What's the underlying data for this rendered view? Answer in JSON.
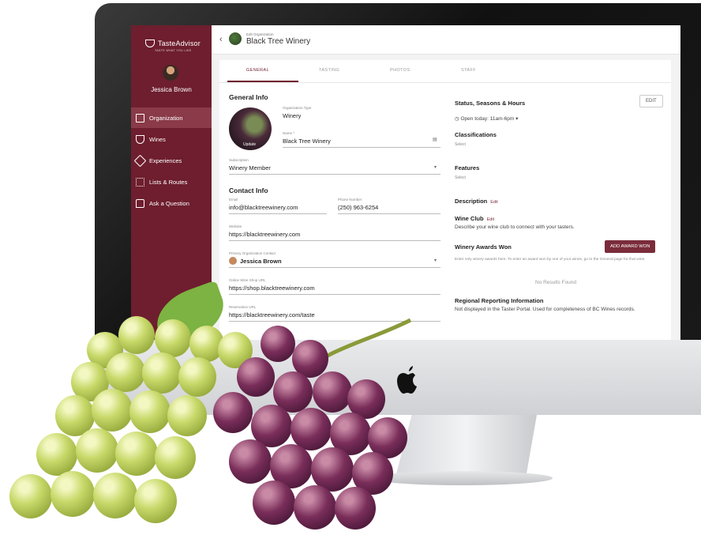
{
  "app": {
    "logo_text": "TasteAdvisor",
    "logo_tagline": "TASTE WHAT YOU LIKE"
  },
  "user": {
    "name": "Jessica Brown"
  },
  "sidebar": {
    "items": [
      {
        "label": "Organization",
        "icon": "building-icon",
        "active": true
      },
      {
        "label": "Wines",
        "icon": "wine-glass-icon"
      },
      {
        "label": "Experiences",
        "icon": "ticket-icon"
      },
      {
        "label": "Lists & Routes",
        "icon": "route-icon"
      },
      {
        "label": "Ask a Question",
        "icon": "chat-icon"
      }
    ]
  },
  "header": {
    "breadcrumb": "Edit Organization",
    "title": "Black Tree Winery"
  },
  "tabs": [
    "GENERAL",
    "TASTING",
    "PHOTOS",
    "STAFF"
  ],
  "general": {
    "heading": "General Info",
    "org_image_label": "Update",
    "org_type_label": "Organization Type",
    "org_type_value": "Winery",
    "name_label": "Name *",
    "name_value": "Black Tree Winery",
    "subscription_label": "Subscription",
    "subscription_value": "Winery Member"
  },
  "contact": {
    "heading": "Contact Info",
    "email_label": "Email",
    "email_value": "info@blacktreewinery.com",
    "phone_label": "Phone Number",
    "phone_value": "(250) 963-6254",
    "website_label": "Website",
    "website_value": "https://blacktreewinery.com",
    "primary_contact_label": "Primary Organization Contact",
    "primary_contact_value": "Jessica Brown",
    "shop_label": "Online Wine Shop URL",
    "shop_value": "https://shop.blacktreewinery.com",
    "reservation_label": "Reservation URL",
    "reservation_value": "https://blacktreewinery.com/taste"
  },
  "right": {
    "status_heading": "Status, Seasons & Hours",
    "edit_label": "EDIT",
    "open_today": "Open today: 11am-6pm",
    "classifications_heading": "Classifications",
    "classifications_value": "Select",
    "features_heading": "Features",
    "features_value": "Select",
    "description_heading": "Description",
    "description_edit": "Edit",
    "wine_club_heading": "Wine Club",
    "wine_club_edit": "Edit",
    "wine_club_text": "Describe your wine club to connect with your tasters.",
    "awards_heading": "Winery Awards Won",
    "add_award_label": "ADD AWARD WON",
    "awards_hint": "Enter only winery awards here. To enter an award won by one of your wines, go to the General page for that wine.",
    "no_results": "No Results Found",
    "regional_heading": "Regional Reporting Information",
    "regional_text": "Not displayed in the Taster Portal. Used for completeness of BC Wines records."
  },
  "colors": {
    "brand": "#6e1e2e",
    "accent": "#7a2c3a"
  }
}
